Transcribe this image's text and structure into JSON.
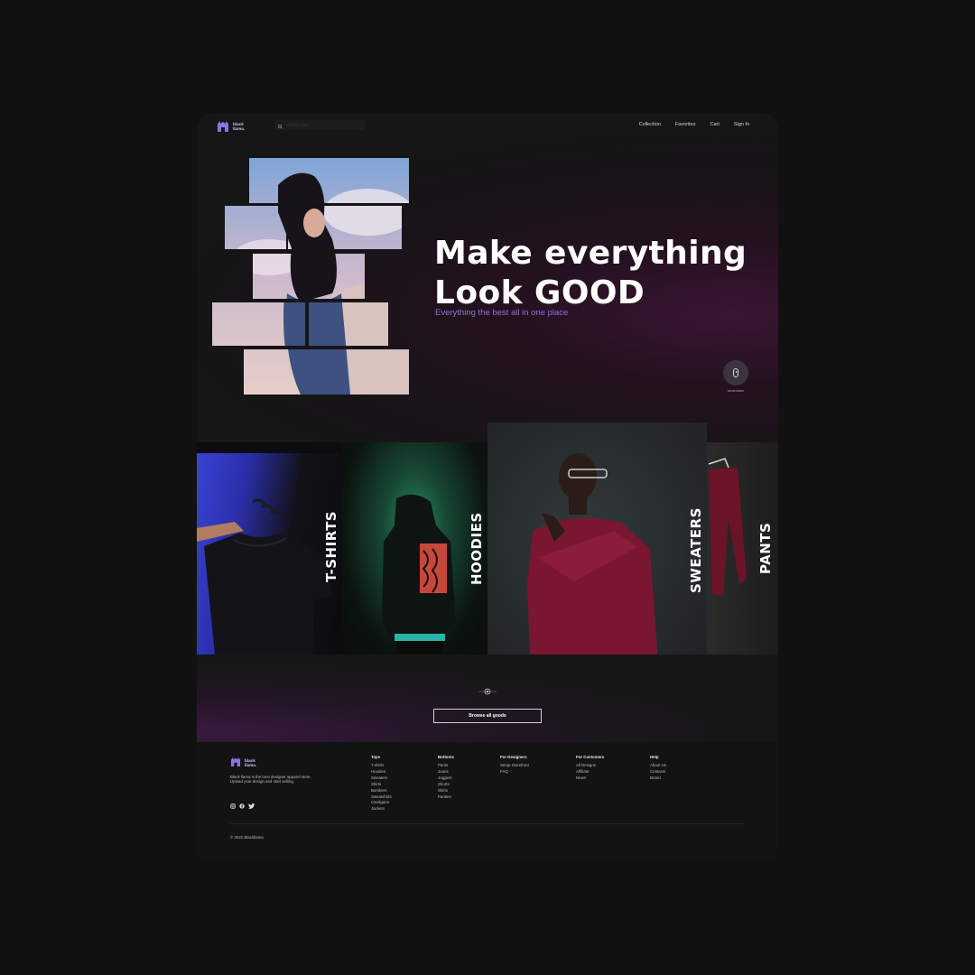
{
  "brand": {
    "name_line1": "black",
    "name_line2": "llama.",
    "accent": "#8d72e4"
  },
  "header": {
    "search_placeholder": "Search here",
    "nav": [
      "Collection",
      "Favorites",
      "Cart",
      "Sign In"
    ]
  },
  "hero": {
    "title_line1": "Make everything",
    "title_line2": "Look GOOD",
    "subtitle": "Everything the best all in one place",
    "scroll_label": "scroll down"
  },
  "categories": [
    "T-SHIRTS",
    "HOODIES",
    "SWEATERS",
    "PANTS"
  ],
  "browse_label": "Browse all goods",
  "footer": {
    "description": "Black llama is the best designer apparel store. Upload your design and start selling.",
    "social_icons": [
      "instagram-icon",
      "facebook-icon",
      "twitter-icon"
    ],
    "columns": [
      {
        "title": "Tops",
        "links": [
          "T-shirts",
          "Hoodies",
          "Sweaters",
          "Shirts",
          "Bombers",
          "Sweatshirts",
          "Cardigans",
          "Jackets"
        ]
      },
      {
        "title": "Bottoms",
        "links": [
          "Pants",
          "Jeans",
          "Joggers",
          "Shorts",
          "Skirts",
          "Panties"
        ]
      },
      {
        "title": "For Designers",
        "links": [
          "Setup Storefront",
          "FAQ"
        ]
      },
      {
        "title": "For Customers",
        "links": [
          "All Designs",
          "Affiliate",
          "News"
        ]
      },
      {
        "title": "Help",
        "links": [
          "About Us",
          "Contacts",
          "Brand"
        ]
      }
    ],
    "copyright": "© 2022 Blackllama"
  }
}
